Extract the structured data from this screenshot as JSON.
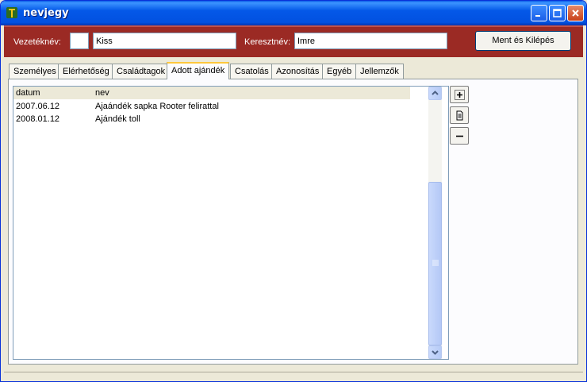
{
  "window": {
    "title": "nevjegy"
  },
  "header": {
    "last_name_label": "Vezetéknév:",
    "prefix_value": "",
    "last_name_value": "Kiss",
    "first_name_label": "Keresztnév:",
    "first_name_value": "Imre",
    "save_exit_label": "Ment és Kilépés"
  },
  "tabs": [
    {
      "label": "Személyes"
    },
    {
      "label": "Elérhetőség"
    },
    {
      "label": "Családtagok"
    },
    {
      "label": "Adott ajándék"
    },
    {
      "label": "Csatolás"
    },
    {
      "label": "Azonosítás"
    },
    {
      "label": "Egyéb"
    },
    {
      "label": "Jellemzők"
    }
  ],
  "active_tab": "Adott ajándék",
  "list": {
    "columns": [
      "datum",
      "nev"
    ],
    "rows": [
      {
        "datum": "2007.06.12",
        "nev": "Ajaándék sapka Rooter felirattal"
      },
      {
        "datum": "2008.01.12",
        "nev": "Ajándék toll"
      }
    ]
  },
  "side_buttons": {
    "add": "plus-icon",
    "edit": "document-icon",
    "remove": "minus-icon"
  },
  "colors": {
    "header_bg": "#9b2a24",
    "titlebar": "#0458e8",
    "active_tab_accent": "#ffc83c"
  }
}
